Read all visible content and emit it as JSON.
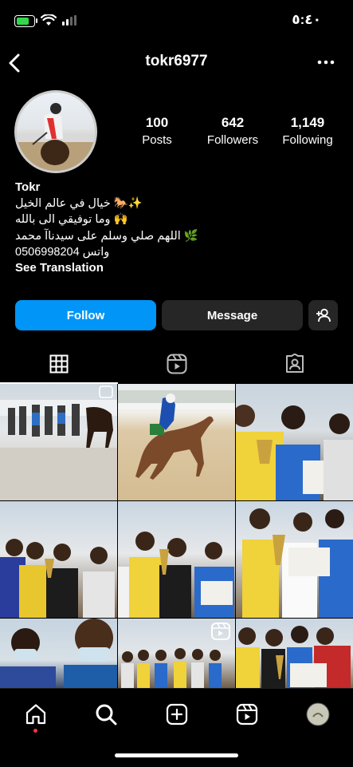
{
  "status_bar": {
    "time": "٥:٤٠"
  },
  "header": {
    "username": "tokr6977"
  },
  "stats": [
    {
      "value": "100",
      "label": "Posts"
    },
    {
      "value": "642",
      "label": "Followers"
    },
    {
      "value": "1,149",
      "label": "Following"
    }
  ],
  "bio": {
    "name": "Tokr",
    "line1": "خيال في عالم الخيل 🐎✨",
    "line2": "وما توفيقي الى بالله 🙌",
    "line3": "اللهم صلي وسلم على سيدناآ محمد 🌿",
    "line4": "واتس 0506998204",
    "see_translation": "See Translation"
  },
  "actions": {
    "follow": "Follow",
    "message": "Message"
  },
  "tabs": [
    {
      "icon": "grid-icon",
      "active": true
    },
    {
      "icon": "reels-icon",
      "active": false
    },
    {
      "icon": "tagged-icon",
      "active": false
    }
  ],
  "bottom_nav": [
    {
      "icon": "home-icon"
    },
    {
      "icon": "search-icon"
    },
    {
      "icon": "create-icon"
    },
    {
      "icon": "reels-icon"
    },
    {
      "icon": "profile-avatar"
    }
  ],
  "colors": {
    "accent": "#0095f6",
    "secondary_button": "#262626",
    "notification_dot": "#ff3040"
  }
}
